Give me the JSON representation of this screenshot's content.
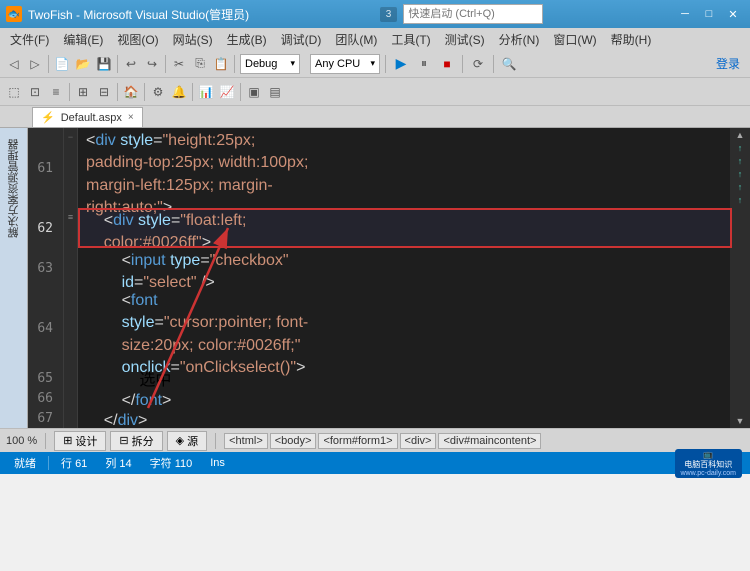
{
  "titlebar": {
    "title": "TwoFish - Microsoft Visual Studio(管理员)",
    "icon": "🐟",
    "search_placeholder": "快速启动 (Ctrl+Q)",
    "min_btn": "─",
    "max_btn": "□",
    "close_btn": "✕",
    "version_badge": "3"
  },
  "menubar": {
    "items": [
      "文件(F)",
      "编辑(E)",
      "视图(O)",
      "网站(S)",
      "生成(B)",
      "调试(D)",
      "团队(M)",
      "工具(T)",
      "测试(S)",
      "分析(N)",
      "窗口(W)",
      "帮助(H)"
    ]
  },
  "toolbar": {
    "debug_label": "Debug",
    "cpu_label": "Any CPU",
    "login_label": "登录"
  },
  "tabs": {
    "active_tab": "Default.aspx",
    "active_tab_icon": "⚡"
  },
  "editor": {
    "lines": [
      {
        "num": "61",
        "content": "    <div style=\"height:25px;",
        "height": "single"
      },
      {
        "num": "",
        "content": "    padding-top:25px; width:100px;",
        "height": "single"
      },
      {
        "num": "",
        "content": "    margin-left:125px; margin-",
        "height": "single"
      },
      {
        "num": "",
        "content": "    right:auto;\">",
        "height": "single"
      },
      {
        "num": "62",
        "content": "        <div style=\"float:left;",
        "height": "single",
        "highlighted": true
      },
      {
        "num": "",
        "content": "        color:#0026ff\">",
        "height": "single",
        "highlighted": true
      },
      {
        "num": "63",
        "content": "            <input type=\"checkbox\"",
        "height": "single"
      },
      {
        "num": "",
        "content": "            id=\"select\" />",
        "height": "single"
      },
      {
        "num": "64",
        "content": "            <font",
        "height": "single"
      },
      {
        "num": "",
        "content": "            style=\"cursor:pointer; font-",
        "height": "single"
      },
      {
        "num": "",
        "content": "            size:20px; color:#0026ff;\"",
        "height": "single"
      },
      {
        "num": "",
        "content": "            onclick=\"onClickselect()\">",
        "height": "single"
      },
      {
        "num": "65",
        "content": "                选中",
        "height": "single"
      },
      {
        "num": "66",
        "content": "            </font>",
        "height": "single"
      },
      {
        "num": "67",
        "content": "        </div>",
        "height": "single"
      }
    ]
  },
  "statusbar": {
    "ready": "就绪",
    "row_label": "行",
    "row_val": "61",
    "col_label": "列",
    "col_val": "14",
    "char_label": "字符",
    "char_val": "110",
    "ins_label": "Ins",
    "logo_text": "电脑百科知识",
    "logo_sub": "www.pc-daily.com"
  },
  "bottom_toolbar": {
    "design_btn": "设计",
    "split_btn": "拆分",
    "source_btn": "源",
    "breadcrumbs": [
      "<html>",
      "<body>",
      "<form#form1>",
      "<div>",
      "<div#maincontent>"
    ]
  },
  "zoom": {
    "label": "100 %"
  },
  "right_panel": {
    "arrows": [
      "↑",
      "↑",
      "↑",
      "↑",
      "↑"
    ],
    "nav_up": "▲",
    "nav_down": "▼"
  }
}
